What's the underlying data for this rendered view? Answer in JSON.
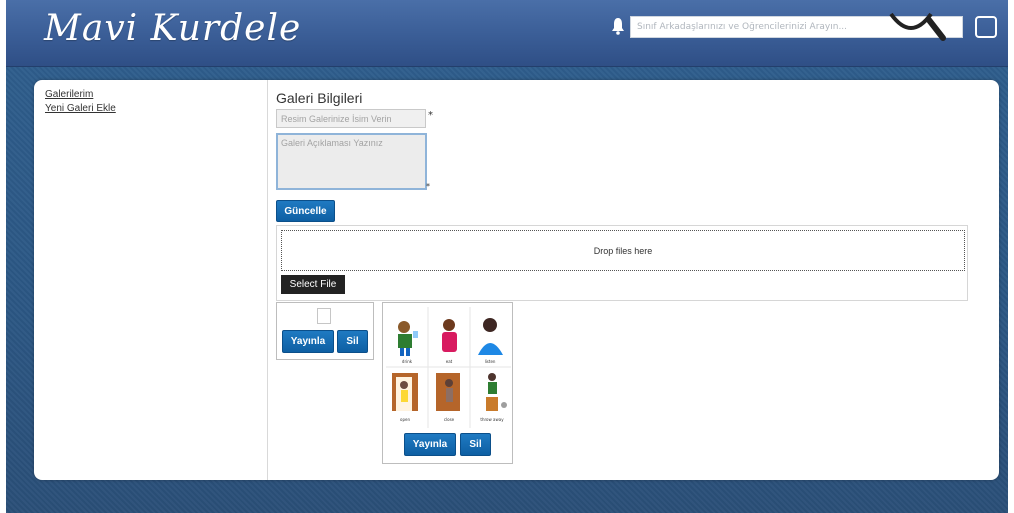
{
  "header": {
    "logo_text": "Mavi Kurdele",
    "search_placeholder": "Sınıf Arkadaşlarınızı ve Öğrencilerinizi Arayın..."
  },
  "sidebar": {
    "items": [
      {
        "label": "Galerilerim"
      },
      {
        "label": "Yeni Galeri Ekle"
      }
    ]
  },
  "form": {
    "title": "Galeri Bilgileri",
    "name_placeholder": "Resim Galerinize İsim Verin",
    "required_mark": "*",
    "description_placeholder": "Galeri Açıklaması Yazınız",
    "update_label": "Güncelle"
  },
  "upload": {
    "dropzone_text": "Drop files here",
    "select_file_label": "Select File"
  },
  "gallery": {
    "items": [
      {
        "publish_label": "Yayınla",
        "delete_label": "Sil"
      },
      {
        "publish_label": "Yayınla",
        "delete_label": "Sil",
        "image_captions": [
          "drink",
          "eat",
          "listen",
          "open",
          "close",
          "throw away"
        ]
      }
    ]
  },
  "colors": {
    "header": "#3a5d96",
    "button": "#1069b0",
    "background": "#2b5784"
  }
}
